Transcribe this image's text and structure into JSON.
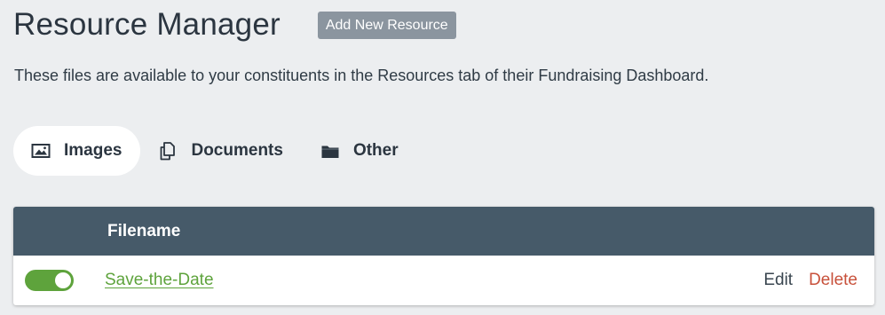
{
  "header": {
    "title": "Resource Manager",
    "add_button_label": "Add New Resource"
  },
  "description": "These files are available to your constituents in the Resources tab of their Fundraising Dashboard.",
  "tabs": [
    {
      "label": "Images",
      "icon": "image-icon",
      "active": true
    },
    {
      "label": "Documents",
      "icon": "documents-icon",
      "active": false
    },
    {
      "label": "Other",
      "icon": "folder-icon",
      "active": false
    }
  ],
  "table": {
    "columns": [
      "Filename"
    ],
    "rows": [
      {
        "enabled": true,
        "filename": "Save-the-Date",
        "edit_label": "Edit",
        "delete_label": "Delete"
      }
    ]
  },
  "colors": {
    "background": "#eceef0",
    "table_header": "#465a69",
    "accent_green": "#5ea33c",
    "delete_red": "#c8513b",
    "button_gray": "#8b959f"
  }
}
